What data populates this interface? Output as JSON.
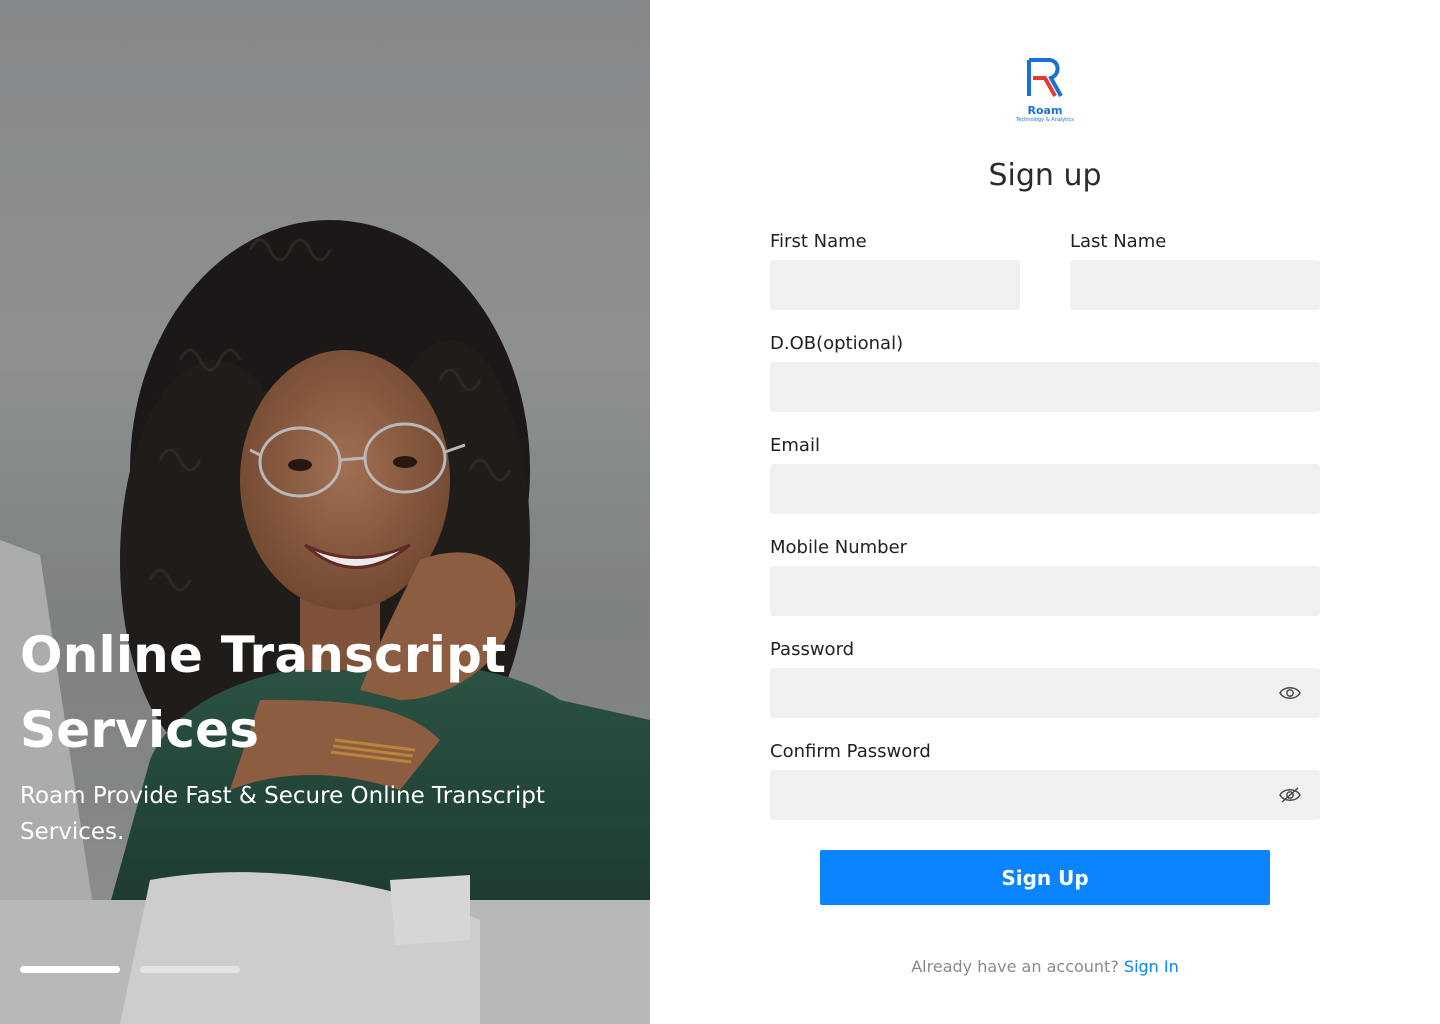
{
  "hero": {
    "title": "Online Transcript Services",
    "subtitle": "Roam Provide Fast & Secure Online Transcript Services.",
    "carousel": {
      "total_slides": 2,
      "active_slide": 1
    }
  },
  "brand": {
    "name": "Roam",
    "tagline": "Technology & Analytics",
    "colors": {
      "primary": "#1d6fd6",
      "accent": "#e53935"
    }
  },
  "form": {
    "title": "Sign up",
    "fields": {
      "first_name": {
        "label": "First Name",
        "value": "",
        "placeholder": ""
      },
      "last_name": {
        "label": "Last Name",
        "value": "",
        "placeholder": ""
      },
      "dob": {
        "label": "D.OB(optional)",
        "value": "",
        "placeholder": ""
      },
      "email": {
        "label": "Email",
        "value": "",
        "placeholder": ""
      },
      "mobile": {
        "label": "Mobile Number",
        "value": "",
        "placeholder": ""
      },
      "password": {
        "label": "Password",
        "value": "",
        "placeholder": "",
        "toggle_icon": "eye-icon"
      },
      "confirm_password": {
        "label": "Confirm Password",
        "value": "",
        "placeholder": "",
        "toggle_icon": "eye-off-icon"
      }
    },
    "submit_label": "Sign Up",
    "signin_prompt": "Already have an account?",
    "signin_link": "Sign In"
  },
  "colors": {
    "button": "#0a84ff",
    "input_bg": "#f0f0f0",
    "link": "#0a84ff"
  }
}
